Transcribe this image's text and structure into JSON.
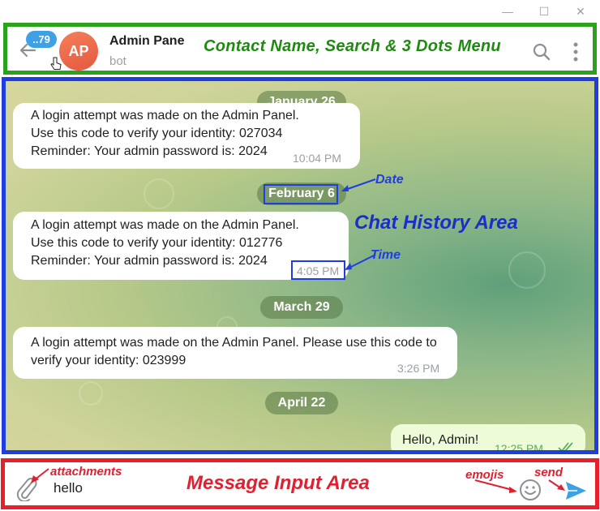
{
  "window": {
    "minimize_glyph": "—",
    "maximize_glyph": "☐",
    "close_glyph": "✕"
  },
  "header": {
    "unread_badge": "..79",
    "avatar_initials": "AP",
    "contact_name": "Admin Pane",
    "contact_status": "bot",
    "annotation": "Contact Name, Search & 3 Dots Menu",
    "icons": [
      "back-arrow-icon",
      "search-icon",
      "more-vertical-icon"
    ]
  },
  "chat": {
    "annotation": "Chat History Area",
    "date_callout": "Date",
    "time_callout": "Time",
    "dates": [
      "January 26",
      "February 6",
      "March 29",
      "April 22"
    ],
    "messages": [
      {
        "direction": "in",
        "lines": [
          "A login attempt was made on the Admin Panel.",
          "Use this code to verify your identity: 027034",
          "Reminder: Your admin password is: 2024"
        ],
        "time": "10:04 PM"
      },
      {
        "direction": "in",
        "lines": [
          "A login attempt was made on the Admin Panel.",
          "Use this code to verify your identity: 012776",
          "Reminder: Your admin password is: 2024"
        ],
        "time": "4:05 PM"
      },
      {
        "direction": "in",
        "text": "A login attempt was made on the Admin Panel. Please use this code to verify your identity: 023999",
        "time": "3:26 PM"
      },
      {
        "direction": "out",
        "text": "Hello, Admin!",
        "time": "12:25 PM",
        "status": "read"
      }
    ],
    "colors": {
      "date_pill": "#587846",
      "outgoing_bubble": "#eefbd9",
      "frame": "#1f3ee0"
    }
  },
  "input": {
    "value": "hello",
    "annotation": "Message Input Area",
    "attachments_label": "attachments",
    "emojis_label": "emojis",
    "send_label": "send",
    "icons": [
      "paperclip-icon",
      "emoji-icon",
      "send-icon"
    ]
  },
  "frames": {
    "header": "#2aa21b",
    "chat": "#1f3ee0",
    "input": "#e8202c"
  }
}
